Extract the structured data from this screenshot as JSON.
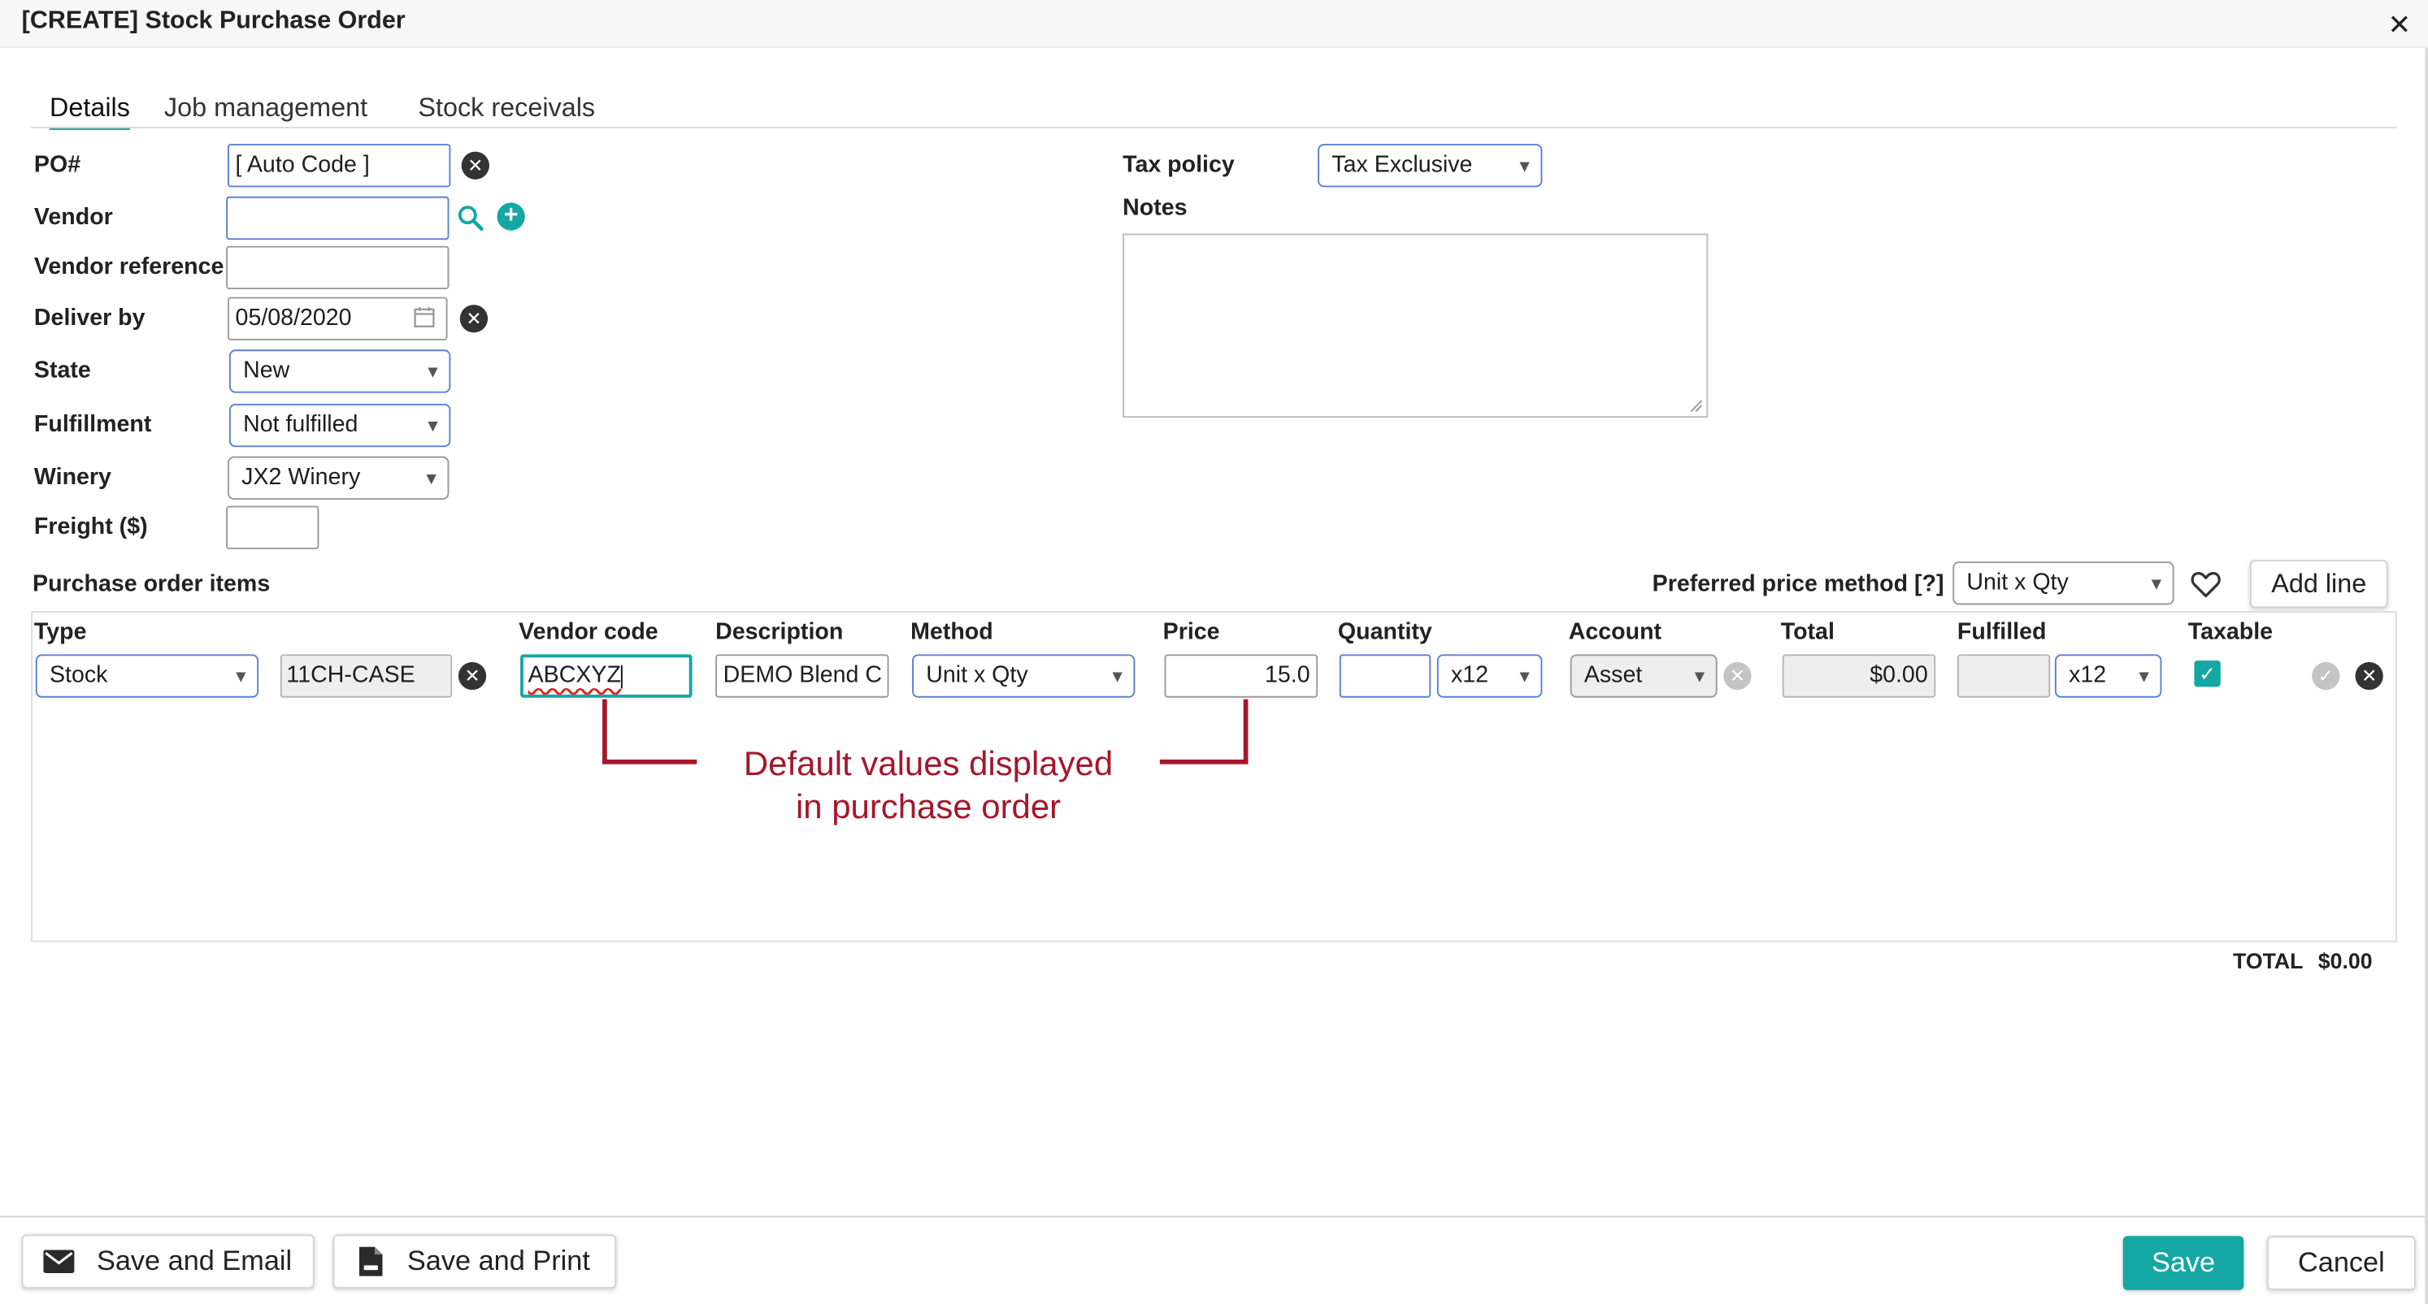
{
  "window": {
    "title": "[CREATE] Stock Purchase Order",
    "close_icon": "close-icon"
  },
  "tabs": [
    {
      "label": "Details",
      "active": true
    },
    {
      "label": "Job management",
      "active": false
    },
    {
      "label": "Stock receivals",
      "active": false
    }
  ],
  "form": {
    "po_label": "PO#",
    "po_value": "[ Auto Code ]",
    "vendor_label": "Vendor",
    "vendor_value": "",
    "vendor_ref_label": "Vendor reference",
    "vendor_ref_value": "",
    "deliver_label": "Deliver by",
    "deliver_value": "05/08/2020",
    "state_label": "State",
    "state_value": "New",
    "fulfillment_label": "Fulfillment",
    "fulfillment_value": "Not fulfilled",
    "winery_label": "Winery",
    "winery_value": "JX2 Winery",
    "freight_label": "Freight ($)",
    "freight_value": ""
  },
  "tax": {
    "label": "Tax policy",
    "value": "Tax Exclusive"
  },
  "notes": {
    "label": "Notes",
    "value": ""
  },
  "items": {
    "section_label": "Purchase order items",
    "price_method_label": "Preferred price method [?]",
    "price_method_value": "Unit x Qty",
    "add_line_label": "Add line",
    "columns": [
      "Type",
      "Vendor code",
      "Description",
      "Method",
      "Price",
      "Quantity",
      "Account",
      "Total",
      "Fulfilled",
      "Taxable"
    ],
    "row": {
      "type": "Stock",
      "item_code": "11CH-CASE",
      "vendor_code": "ABCXYZ",
      "description": "DEMO Blend C",
      "method": "Unit x Qty",
      "price": "15.0",
      "quantity": "",
      "quantity_unit": "x12",
      "account": "Asset",
      "total": "$0.00",
      "fulfilled": "",
      "fulfilled_unit": "x12",
      "taxable": true
    },
    "total_label": "TOTAL",
    "total_value": "$0.00"
  },
  "annotation": {
    "line1": "Default values displayed",
    "line2": "in purchase order",
    "color": "#a5162a"
  },
  "footer": {
    "save_email_label": "Save and Email",
    "save_print_label": "Save and Print",
    "save_label": "Save",
    "cancel_label": "Cancel"
  },
  "colors": {
    "accent": "#14a7a3",
    "input_border": "#5b7fd6"
  }
}
